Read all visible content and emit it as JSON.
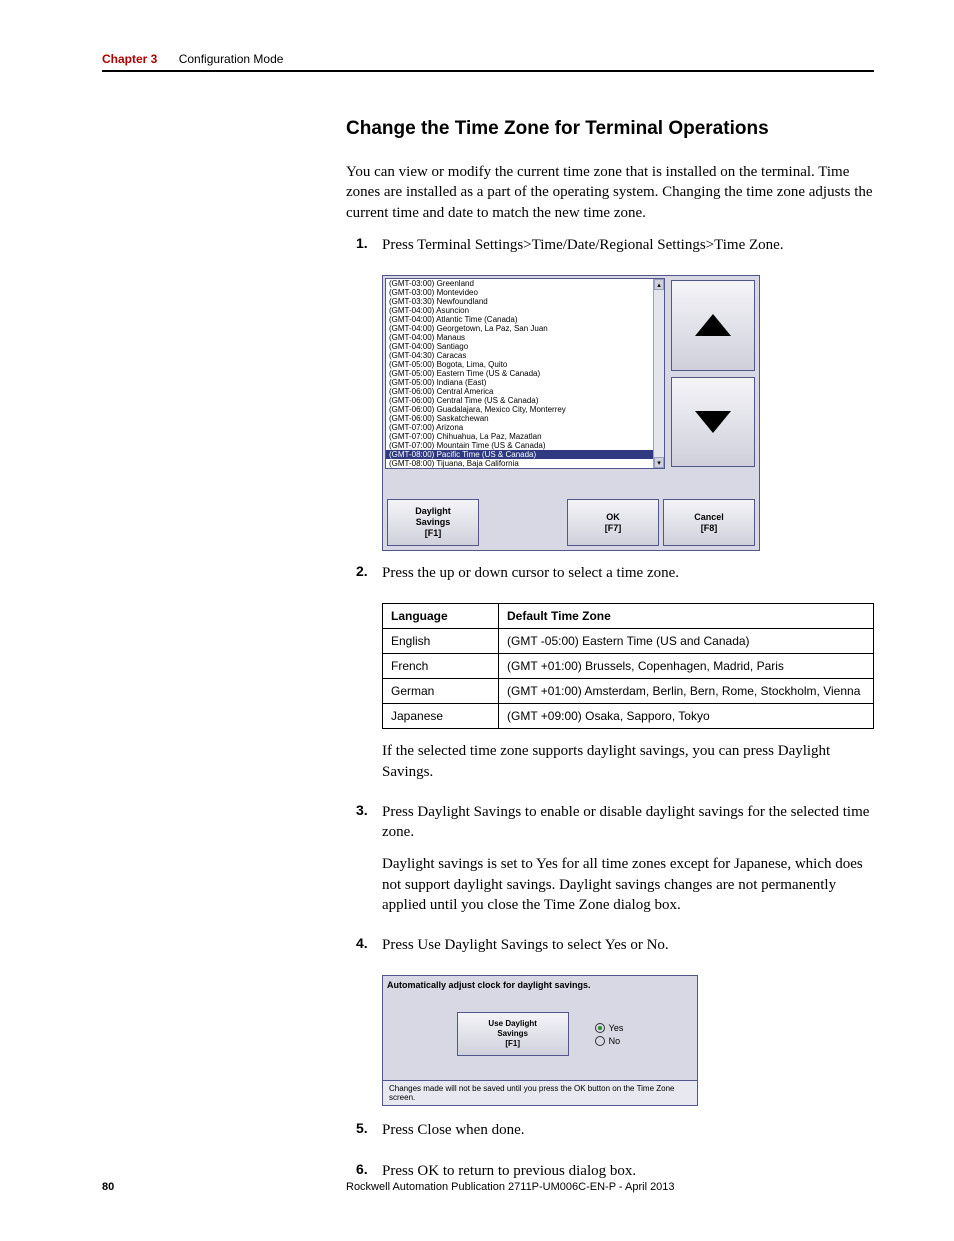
{
  "header": {
    "chapter_label": "Chapter 3",
    "chapter_title": "Configuration Mode"
  },
  "heading": "Change the Time Zone for Terminal Operations",
  "intro": "You can view or modify the current time zone that is installed on the terminal. Time zones are installed as a part of the operating system. Changing the time zone adjusts the current time and date to match the new time zone.",
  "steps": {
    "s1_num": "1.",
    "s1_text": "Press Terminal Settings>Time/Date/Regional Settings>Time Zone.",
    "s2_num": "2.",
    "s2_text": "Press the up or down cursor to select a time zone.",
    "s2_post": "If the selected time zone supports daylight savings, you can press Daylight Savings.",
    "s3_num": "3.",
    "s3_text": "Press Daylight Savings to enable or disable daylight savings for the selected time zone.",
    "s3_post": "Daylight savings is set to Yes for all time zones except for Japanese, which does not support daylight savings. Daylight savings changes are not permanently applied until you close the Time Zone dialog box.",
    "s4_num": "4.",
    "s4_text": "Press Use Daylight Savings to select Yes or No.",
    "s5_num": "5.",
    "s5_text": "Press Close when done.",
    "s6_num": "6.",
    "s6_text": "Press OK to return to previous dialog box."
  },
  "dialog1": {
    "items": [
      "(GMT-03:00) Greenland",
      "(GMT-03:00) Montevideo",
      "(GMT-03:30) Newfoundland",
      "(GMT-04:00) Asuncion",
      "(GMT-04:00) Atlantic Time (Canada)",
      "(GMT-04:00) Georgetown, La Paz, San Juan",
      "(GMT-04:00) Manaus",
      "(GMT-04:00) Santiago",
      "(GMT-04:30) Caracas",
      "(GMT-05:00) Bogota, Lima, Quito",
      "(GMT-05:00) Eastern Time (US & Canada)",
      "(GMT-05:00) Indiana (East)",
      "(GMT-06:00) Central America",
      "(GMT-06:00) Central Time (US & Canada)",
      "(GMT-06:00) Guadalajara, Mexico City, Monterrey",
      "(GMT-06:00) Saskatchewan",
      "(GMT-07:00) Arizona",
      "(GMT-07:00) Chihuahua, La Paz, Mazatlan",
      "(GMT-07:00) Mountain Time (US & Canada)",
      "(GMT-08:00) Pacific Time (US & Canada)",
      "(GMT-08:00) Tijuana, Baja California"
    ],
    "selected_index": 19,
    "btn_daylight_l1": "Daylight",
    "btn_daylight_l2": "Savings",
    "btn_daylight_l3": "[F1]",
    "btn_ok_l1": "OK",
    "btn_ok_l2": "[F7]",
    "btn_cancel_l1": "Cancel",
    "btn_cancel_l2": "[F8]"
  },
  "table": {
    "h1": "Language",
    "h2": "Default Time Zone",
    "rows": [
      {
        "lang": "English",
        "tz": "(GMT -05:00) Eastern Time (US and Canada)"
      },
      {
        "lang": "French",
        "tz": "(GMT +01:00) Brussels, Copenhagen, Madrid, Paris"
      },
      {
        "lang": "German",
        "tz": "(GMT +01:00) Amsterdam, Berlin, Bern, Rome, Stockholm, Vienna"
      },
      {
        "lang": "Japanese",
        "tz": "(GMT +09:00) Osaka, Sapporo, Tokyo"
      }
    ]
  },
  "dialog2": {
    "title": "Automatically adjust clock for daylight savings.",
    "btn_l1": "Use Daylight",
    "btn_l2": "Savings",
    "btn_l3": "[F1]",
    "yes": "Yes",
    "no": "No",
    "note": "Changes made will not be saved until you press the OK button on the Time Zone screen."
  },
  "footer": {
    "pagenum": "80",
    "publication": "Rockwell Automation Publication 2711P-UM006C-EN-P - April 2013"
  }
}
